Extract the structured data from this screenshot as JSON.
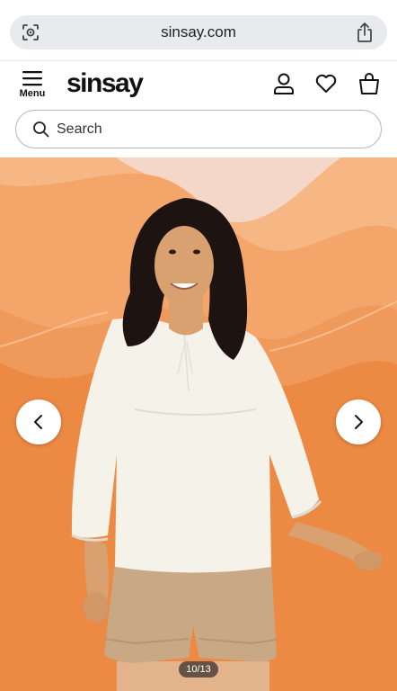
{
  "browser": {
    "url": "sinsay.com",
    "lens_icon": "camera-search-icon",
    "share_icon": "share-icon"
  },
  "header": {
    "menu_label": "Menu",
    "logo_text": "sinsay",
    "icons": [
      "account-icon",
      "heart-icon",
      "shopping-bag-icon"
    ]
  },
  "search": {
    "placeholder": "Search"
  },
  "gallery": {
    "counter": "10/13",
    "current": 10,
    "total": 13,
    "prev_icon": "chevron-left-icon",
    "next_icon": "chevron-right-icon"
  },
  "colors": {
    "background_orange": "#f29a55",
    "url_bar": "#e8eaed"
  }
}
